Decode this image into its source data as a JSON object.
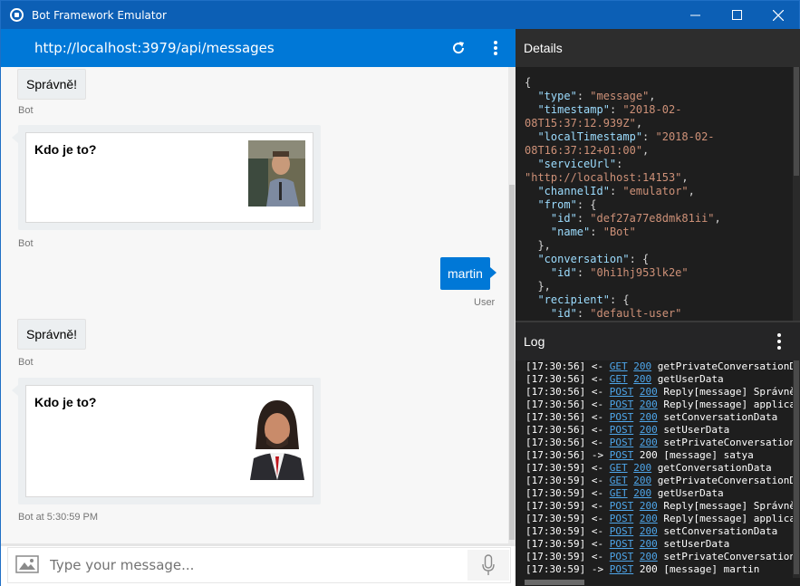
{
  "window": {
    "title": "Bot Framework Emulator"
  },
  "chat": {
    "url": "http://localhost:3979/api/messages",
    "messages": {
      "m1_text": "Správně!",
      "m1_meta": "Bot",
      "card1_title": "Kdo je to?",
      "card1_meta": "Bot",
      "user_text": "martin",
      "user_meta": "User",
      "m2_text": "Správně!",
      "m2_meta": "Bot",
      "card2_title": "Kdo je to?",
      "card2_meta": "Bot at 5:30:59 PM"
    },
    "composer": {
      "placeholder": "Type your message..."
    }
  },
  "details": {
    "title": "Details",
    "json_lines": [
      [
        [
          "p",
          "{"
        ]
      ],
      [
        [
          "p",
          "  "
        ],
        [
          "k",
          "\"type\""
        ],
        [
          "p",
          ": "
        ],
        [
          "s",
          "\"message\""
        ],
        [
          "p",
          ","
        ]
      ],
      [
        [
          "p",
          "  "
        ],
        [
          "k",
          "\"timestamp\""
        ],
        [
          "p",
          ": "
        ],
        [
          "s",
          "\"2018-02-"
        ]
      ],
      [
        [
          "s",
          "08T15:37:12.939Z\""
        ],
        [
          "p",
          ","
        ]
      ],
      [
        [
          "p",
          "  "
        ],
        [
          "k",
          "\"localTimestamp\""
        ],
        [
          "p",
          ": "
        ],
        [
          "s",
          "\"2018-02-"
        ]
      ],
      [
        [
          "s",
          "08T16:37:12+01:00\""
        ],
        [
          "p",
          ","
        ]
      ],
      [
        [
          "p",
          "  "
        ],
        [
          "k",
          "\"serviceUrl\""
        ],
        [
          "p",
          ":"
        ]
      ],
      [
        [
          "s",
          "\"http://localhost:14153\""
        ],
        [
          "p",
          ","
        ]
      ],
      [
        [
          "p",
          "  "
        ],
        [
          "k",
          "\"channelId\""
        ],
        [
          "p",
          ": "
        ],
        [
          "s",
          "\"emulator\""
        ],
        [
          "p",
          ","
        ]
      ],
      [
        [
          "p",
          "  "
        ],
        [
          "k",
          "\"from\""
        ],
        [
          "p",
          ": {"
        ]
      ],
      [
        [
          "p",
          "    "
        ],
        [
          "k",
          "\"id\""
        ],
        [
          "p",
          ": "
        ],
        [
          "s",
          "\"def27a77e8dmk81ii\""
        ],
        [
          "p",
          ","
        ]
      ],
      [
        [
          "p",
          "    "
        ],
        [
          "k",
          "\"name\""
        ],
        [
          "p",
          ": "
        ],
        [
          "s",
          "\"Bot\""
        ]
      ],
      [
        [
          "p",
          "  },"
        ]
      ],
      [
        [
          "p",
          "  "
        ],
        [
          "k",
          "\"conversation\""
        ],
        [
          "p",
          ": {"
        ]
      ],
      [
        [
          "p",
          "    "
        ],
        [
          "k",
          "\"id\""
        ],
        [
          "p",
          ": "
        ],
        [
          "s",
          "\"0hi1hj953lk2e\""
        ]
      ],
      [
        [
          "p",
          "  },"
        ]
      ],
      [
        [
          "p",
          "  "
        ],
        [
          "k",
          "\"recipient\""
        ],
        [
          "p",
          ": {"
        ]
      ],
      [
        [
          "p",
          "    "
        ],
        [
          "k",
          "\"id\""
        ],
        [
          "p",
          ": "
        ],
        [
          "s",
          "\"default-user\""
        ]
      ]
    ]
  },
  "log": {
    "title": "Log",
    "lines": [
      {
        "time": "[17:30:56]",
        "dir": "<-",
        "method": "GET",
        "status": "200",
        "text": "getPrivateConversationD",
        "link": true
      },
      {
        "time": "[17:30:56]",
        "dir": "<-",
        "method": "GET",
        "status": "200",
        "text": "getUserData",
        "link": true
      },
      {
        "time": "[17:30:56]",
        "dir": "<-",
        "method": "POST",
        "status": "200",
        "text": "Reply[message] Správně",
        "link": true
      },
      {
        "time": "[17:30:56]",
        "dir": "<-",
        "method": "POST",
        "status": "200",
        "text": "Reply[message] applica",
        "link": true
      },
      {
        "time": "[17:30:56]",
        "dir": "<-",
        "method": "POST",
        "status": "200",
        "text": "setConversationData",
        "link": true
      },
      {
        "time": "[17:30:56]",
        "dir": "<-",
        "method": "POST",
        "status": "200",
        "text": "setUserData",
        "link": true
      },
      {
        "time": "[17:30:56]",
        "dir": "<-",
        "method": "POST",
        "status": "200",
        "text": "setPrivateConversation",
        "link": true
      },
      {
        "time": "[17:30:56]",
        "dir": "->",
        "method": "POST",
        "status": "200",
        "text": "[message] satya",
        "link": false
      },
      {
        "time": "[17:30:59]",
        "dir": "<-",
        "method": "GET",
        "status": "200",
        "text": "getConversationData",
        "link": true
      },
      {
        "time": "[17:30:59]",
        "dir": "<-",
        "method": "GET",
        "status": "200",
        "text": "getPrivateConversationD",
        "link": true
      },
      {
        "time": "[17:30:59]",
        "dir": "<-",
        "method": "GET",
        "status": "200",
        "text": "getUserData",
        "link": true
      },
      {
        "time": "[17:30:59]",
        "dir": "<-",
        "method": "POST",
        "status": "200",
        "text": "Reply[message] Správně",
        "link": true
      },
      {
        "time": "[17:30:59]",
        "dir": "<-",
        "method": "POST",
        "status": "200",
        "text": "Reply[message] applica",
        "link": true
      },
      {
        "time": "[17:30:59]",
        "dir": "<-",
        "method": "POST",
        "status": "200",
        "text": "setConversationData",
        "link": true
      },
      {
        "time": "[17:30:59]",
        "dir": "<-",
        "method": "POST",
        "status": "200",
        "text": "setUserData",
        "link": true
      },
      {
        "time": "[17:30:59]",
        "dir": "<-",
        "method": "POST",
        "status": "200",
        "text": "setPrivateConversation",
        "link": true
      },
      {
        "time": "[17:30:59]",
        "dir": "->",
        "method": "POST",
        "status": "200",
        "text": "[message] martin",
        "link": false
      }
    ]
  },
  "colors": {
    "accent": "#0078d7",
    "titlebar": "#0c5fb5",
    "panel_dark": "#1e1e1e",
    "json_key": "#9cdcfe",
    "json_string": "#ce9178",
    "log_link": "#4ea6ea"
  }
}
